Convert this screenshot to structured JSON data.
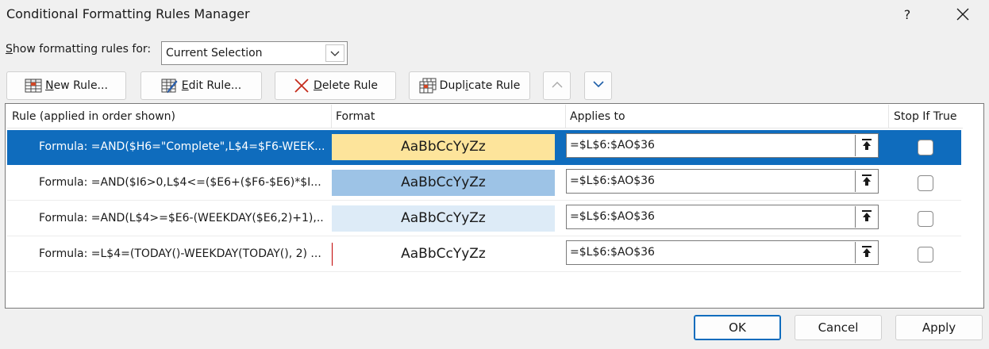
{
  "window": {
    "title": "Conditional Formatting Rules Manager",
    "help_label": "?"
  },
  "scope": {
    "label_accel": "S",
    "label_rest": "how formatting rules for:",
    "selected": "Current Selection"
  },
  "toolbar": {
    "new_rule_accel": "N",
    "new_rule_rest": "ew Rule...",
    "edit_rule_accel": "E",
    "edit_rule_rest": "dit Rule...",
    "delete_rule_accel": "D",
    "delete_rule_rest": "elete Rule",
    "duplicate_pre": "Dupl",
    "duplicate_accel": "i",
    "duplicate_post": "cate Rule"
  },
  "table": {
    "headers": {
      "rule": "Rule (applied in order shown)",
      "format": "Format",
      "applies_to": "Applies to",
      "stop_if_true": "Stop If True"
    },
    "rows": [
      {
        "rule": "Formula: =AND($H6=\"Complete\",L$4=$F6-WEEK...",
        "preview": "AaBbCcYyZz",
        "fill": "#fde49b",
        "applies_to": "=$L$6:$AO$36",
        "stop_if_true": false,
        "selected": true
      },
      {
        "rule": "Formula: =AND($I6>0,L$4<=($E6+($F6-$E6)*$I...",
        "preview": "AaBbCcYyZz",
        "fill": "#9dc3e6",
        "applies_to": "=$L$6:$AO$36",
        "stop_if_true": false,
        "selected": false
      },
      {
        "rule": "Formula: =AND(L$4>=$E6-(WEEKDAY($E6,2)+1),...",
        "preview": "AaBbCcYyZz",
        "fill": "#ddebf7",
        "applies_to": "=$L$6:$AO$36",
        "stop_if_true": false,
        "selected": false
      },
      {
        "rule": "Formula: =L$4=(TODAY()-WEEKDAY(TODAY(), 2) ...",
        "preview": "AaBbCcYyZz",
        "fill": "#ffffff",
        "applies_to": "=$L$6:$AO$36",
        "stop_if_true": false,
        "selected": false
      }
    ]
  },
  "footer": {
    "ok": "OK",
    "cancel": "Cancel",
    "apply": "Apply"
  },
  "colors": {
    "selection": "#0f6cbd",
    "delete_icon": "#c42b1c"
  }
}
